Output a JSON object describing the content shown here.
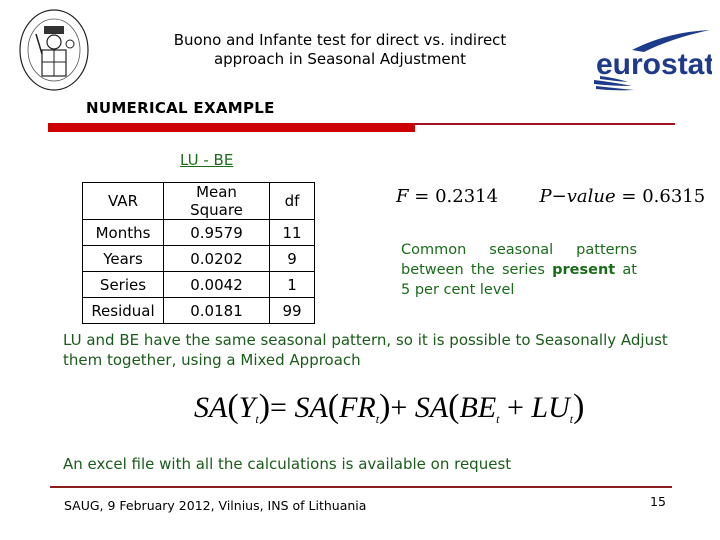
{
  "header": {
    "title_line1": "Buono and Infante test for direct vs. indirect",
    "title_line2": "approach in Seasonal Adjustment",
    "left_logo": "university-seal-logo",
    "right_logo": "eurostat-logo",
    "right_logo_text": "eurostat"
  },
  "section": {
    "heading": "NUMERICAL EXAMPLE",
    "subtitle": "LU - BE",
    "accent_color": "#cc0000"
  },
  "table": {
    "headers": [
      "VAR",
      "Mean Square",
      "df"
    ],
    "rows": [
      [
        "Months",
        "0.9579",
        "11"
      ],
      [
        "Years",
        "0.0202",
        "9"
      ],
      [
        "Series",
        "0.0042",
        "1"
      ],
      [
        "Residual",
        "0.0181",
        "99"
      ]
    ]
  },
  "stats": {
    "f_label": "F",
    "f_value": "0.2314",
    "p_label": "P",
    "p_minus": "−",
    "p_word": "value",
    "p_value": "0.6315",
    "eq": "="
  },
  "note": {
    "text_before": "Common seasonal patterns between the series ",
    "bold": "present",
    "text_after": " at 5 per cent level",
    "color": "#1a6b1a"
  },
  "paragraph": "LU and BE have the same seasonal pattern, so it is possible to Seasonally Adjust them together, using a Mixed Approach",
  "equation": {
    "sa": "SA",
    "y": "Y",
    "fr": "FR",
    "be": "BE",
    "lu": "LU",
    "t": "t",
    "eq": "=",
    "plus": "+",
    "lparen": "(",
    "rparen": ")"
  },
  "request_note": "An excel file with all the calculations is available on request",
  "footer": {
    "text": "SAUG, 9 February 2012, Vilnius, INS of Lithuania",
    "page_number": "15"
  }
}
